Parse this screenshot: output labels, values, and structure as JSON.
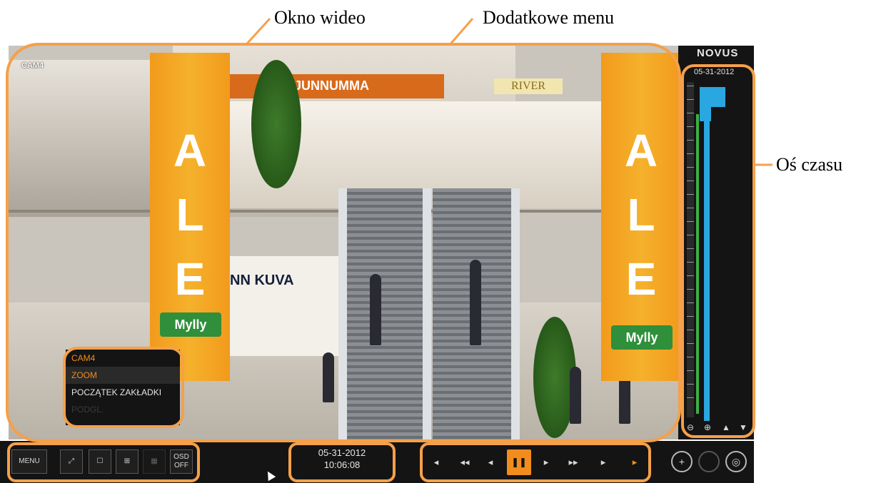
{
  "annotations": {
    "video_window": "Okno wideo",
    "extra_menu": "Dodatkowe menu",
    "timeline": "Oś czasu"
  },
  "video": {
    "camera_label": "CAM4",
    "store_sign": "JUNNUMMA",
    "river_sign": "RIVER",
    "kuva_sign": "NN KUVA",
    "banner_letters": [
      "A",
      "L",
      "E"
    ],
    "mylly_logo": "Mylly"
  },
  "context_menu": {
    "items": [
      {
        "label": "CAM4"
      },
      {
        "label": "ZOOM"
      },
      {
        "label": "POCZĄTEK ZAKŁADKI"
      },
      {
        "label": "PODGL."
      }
    ]
  },
  "timeline": {
    "brand": "NOVUS",
    "date": "05-31-2012",
    "buttons": [
      "zoom-out-icon",
      "zoom-in-icon",
      "up-arrow-icon",
      "down-arrow-icon"
    ]
  },
  "toolbar": {
    "menu_label": "MENU",
    "osd_label": "OSD OFF",
    "date": "05-31-2012",
    "time": "10:06:08"
  },
  "colors": {
    "annotation_orange": "#f5a04a",
    "accent_orange": "#f28c1c",
    "record_blue": "#2aa6e0",
    "bar_bg": "#141414"
  }
}
